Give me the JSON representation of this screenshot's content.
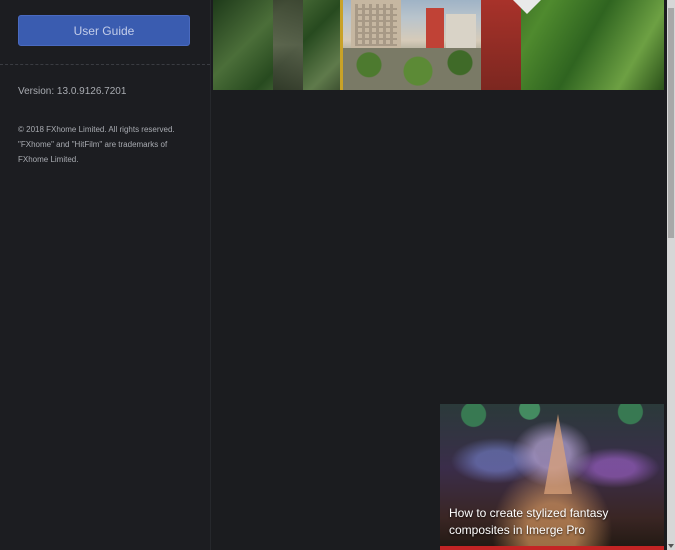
{
  "sidebar": {
    "user_guide_label": "User Guide",
    "version": "Version: 13.0.9126.7201",
    "copyright_lines": [
      "© 2018 FXhome Limited. All rights reserved.",
      "\"FXhome\" and \"HitFilm\" are trademarks of",
      "FXhome Limited."
    ]
  },
  "main": {
    "card": {
      "caption": "How to create stylized fantasy composites in Imerge Pro"
    }
  },
  "colors": {
    "button": "#3a5cb0",
    "background": "#1b1c1f",
    "card_bar": "#c42424"
  }
}
